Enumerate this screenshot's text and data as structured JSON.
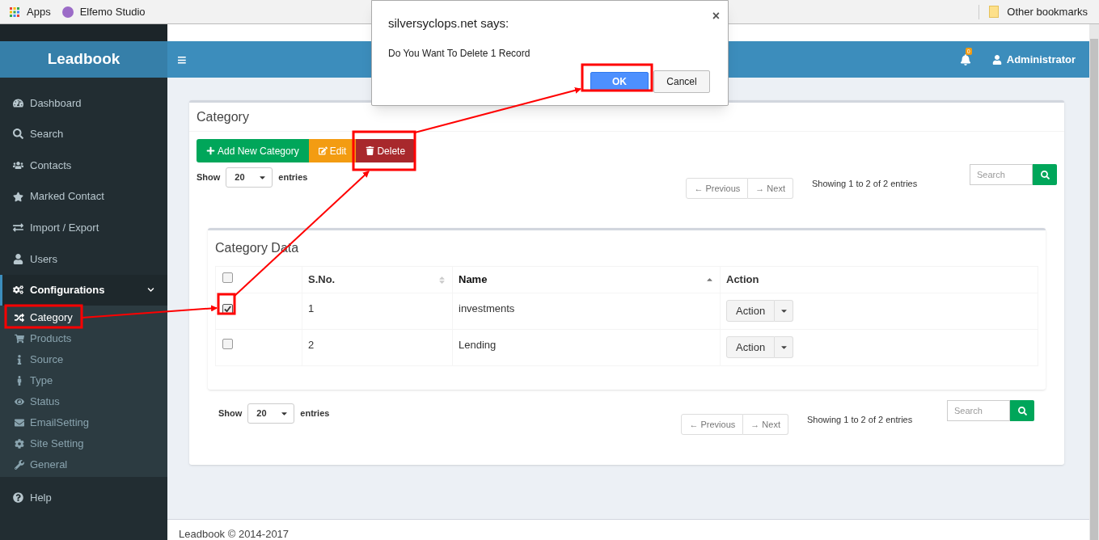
{
  "browser": {
    "bookmarks": [
      {
        "label": "Apps"
      },
      {
        "label": "Elfemo Studio"
      }
    ],
    "other_bookmarks": "Other bookmarks"
  },
  "sidebar": {
    "brand": "Leadbook",
    "items": [
      {
        "label": "Dashboard",
        "selected": false
      },
      {
        "label": "Search",
        "selected": false
      },
      {
        "label": "Contacts",
        "selected": false
      },
      {
        "label": "Marked Contact",
        "selected": false
      },
      {
        "label": "Import / Export",
        "selected": false
      },
      {
        "label": "Users",
        "selected": false
      },
      {
        "label": "Configurations",
        "selected": true,
        "expanded": true,
        "children": [
          {
            "label": "Category",
            "selected": true
          },
          {
            "label": "Products",
            "selected": false
          },
          {
            "label": "Source",
            "selected": false
          },
          {
            "label": "Type",
            "selected": false
          },
          {
            "label": "Status",
            "selected": false
          },
          {
            "label": "EmailSetting",
            "selected": false
          },
          {
            "label": "Site Setting",
            "selected": false
          },
          {
            "label": "General",
            "selected": false
          }
        ]
      },
      {
        "label": "Help",
        "selected": false
      }
    ]
  },
  "header": {
    "menu_glyph": "≡",
    "notifications": "0",
    "user": "Administrator"
  },
  "panel": {
    "title": "Category",
    "buttons": [
      {
        "kind": "add",
        "label": "Add New Category"
      },
      {
        "kind": "edit",
        "label": "Edit"
      },
      {
        "kind": "delete",
        "label": "Delete"
      }
    ],
    "top_controls": {
      "show": "Show",
      "page_size": "20",
      "entries": "entries",
      "previous": "← Previous",
      "next": "→ Next",
      "info": "Showing 1 to 2 of 2 entries",
      "search_placeholder": "Search"
    },
    "table_box": {
      "title": "Category Data",
      "select_all": {
        "checked": false
      },
      "columns": [
        {
          "label": "S.No.",
          "sortable": true,
          "sorted": false
        },
        {
          "label": "Name",
          "sortable": true,
          "sorted": true
        },
        {
          "label": "Action",
          "sortable": false,
          "sorted": false
        }
      ],
      "rows": [
        {
          "checked": true,
          "sno": "1",
          "name": "investments",
          "action": "Action"
        },
        {
          "checked": false,
          "sno": "2",
          "name": "Lending",
          "action": "Action"
        }
      ]
    },
    "bottom_controls": {
      "show": "Show",
      "page_size": "20",
      "entries": "entries",
      "previous": "← Previous",
      "next": "→ Next",
      "info": "Showing 1 to 2 of 2 entries",
      "search_placeholder": "Search"
    }
  },
  "footer": "Leadbook © 2014-2017",
  "dialog": {
    "title": "silversyclops.net says:",
    "message": "Do You Want To Delete 1 Record",
    "close": "×",
    "ok": "OK",
    "cancel": "Cancel"
  }
}
